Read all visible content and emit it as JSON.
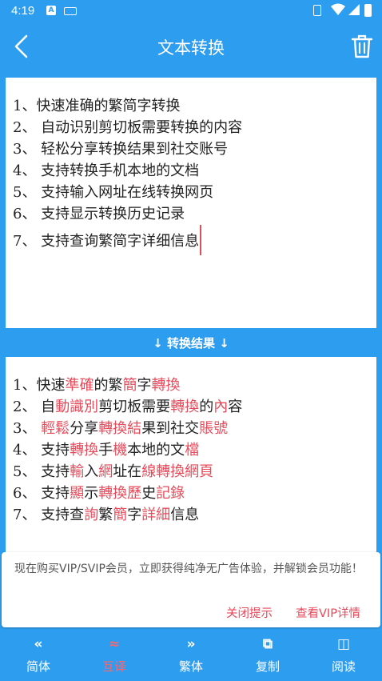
{
  "status": {
    "time": "4:19",
    "notif": "A"
  },
  "appbar": {
    "title": "文本转换",
    "back_icon": "back-arrow-icon",
    "trash_icon": "trash-icon"
  },
  "input_lines": [
    "1、快速准确的繁简字转换",
    "2、 自动识别剪切板需要转换的内容",
    "3、 轻松分享转换结果到社交账号",
    "4、 支持转换手机本地的文档",
    "5、 支持输入网址在线转换网页",
    "6、 支持显示转换历史记录",
    "7、 支持查询繁简字详细信息"
  ],
  "divider": {
    "text": "↓ 转换结果 ↓"
  },
  "output_lines": [
    [
      {
        "t": "1、快速"
      },
      {
        "t": "準確",
        "hl": true
      },
      {
        "t": "的繁"
      },
      {
        "t": "簡",
        "hl": true
      },
      {
        "t": "字"
      },
      {
        "t": "轉換",
        "hl": true
      }
    ],
    [
      {
        "t": "2、 自"
      },
      {
        "t": "動識別",
        "hl": true
      },
      {
        "t": "剪切板需要"
      },
      {
        "t": "轉換",
        "hl": true
      },
      {
        "t": "的"
      },
      {
        "t": "內",
        "hl": true
      },
      {
        "t": "容"
      }
    ],
    [
      {
        "t": "3、 "
      },
      {
        "t": "輕鬆",
        "hl": true
      },
      {
        "t": "分享"
      },
      {
        "t": "轉換結",
        "hl": true
      },
      {
        "t": "果到社交"
      },
      {
        "t": "賬號",
        "hl": true
      }
    ],
    [
      {
        "t": "4、 支持"
      },
      {
        "t": "轉換",
        "hl": true
      },
      {
        "t": "手"
      },
      {
        "t": "機",
        "hl": true
      },
      {
        "t": "本地的文"
      },
      {
        "t": "檔",
        "hl": true
      }
    ],
    [
      {
        "t": "5、 支持"
      },
      {
        "t": "輸",
        "hl": true
      },
      {
        "t": "入"
      },
      {
        "t": "網",
        "hl": true
      },
      {
        "t": "址在"
      },
      {
        "t": "線轉換網頁",
        "hl": true
      }
    ],
    [
      {
        "t": "6、 支持"
      },
      {
        "t": "顯",
        "hl": true
      },
      {
        "t": "示"
      },
      {
        "t": "轉換歷",
        "hl": true
      },
      {
        "t": "史"
      },
      {
        "t": "記錄",
        "hl": true
      }
    ],
    [
      {
        "t": "7、 支持查"
      },
      {
        "t": "詢",
        "hl": true
      },
      {
        "t": "繁"
      },
      {
        "t": "簡",
        "hl": true
      },
      {
        "t": "字"
      },
      {
        "t": "詳細",
        "hl": true
      },
      {
        "t": "信息"
      }
    ]
  ],
  "promo": {
    "message": "现在购买VIP/SVIP会员，立即获得纯净无广告体验，并解锁会员功能！",
    "close_label": "关闭提示",
    "vip_label": "查看VIP详情"
  },
  "tabs": [
    {
      "icon": "«",
      "label": "简体",
      "icon_name": "simplified-icon",
      "active": false
    },
    {
      "icon": "≈",
      "label": "互译",
      "icon_name": "translate-icon",
      "active": true
    },
    {
      "icon": "»",
      "label": "繁体",
      "icon_name": "traditional-icon",
      "active": false
    },
    {
      "icon": "⧉",
      "label": "复制",
      "icon_name": "copy-icon",
      "active": false
    },
    {
      "icon": "◫",
      "label": "阅读",
      "icon_name": "read-icon",
      "active": false
    }
  ],
  "colors": {
    "primary": "#2d9df0",
    "highlight": "#e84a5a",
    "active_tab": "#f06a78"
  }
}
